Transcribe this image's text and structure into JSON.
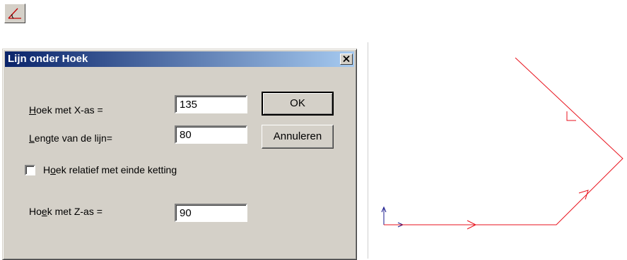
{
  "toolbar": {
    "icon": "angle-line-icon"
  },
  "dialog": {
    "title": "Lijn onder Hoek",
    "fields": [
      {
        "label_u": "H",
        "label_rest": "oek met X-as =",
        "value": "135"
      },
      {
        "label_u": "L",
        "label_rest": "engte van de lijn=",
        "value": "80"
      }
    ],
    "checkbox": {
      "label_pre": "H",
      "label_u": "o",
      "label_rest": "ek relatief met einde ketting",
      "checked": false
    },
    "z_field": {
      "label_pre": "Ho",
      "label_u": "e",
      "label_rest": "k met Z-as =",
      "value": "90"
    },
    "ok_label": "OK",
    "cancel_label": "Annuleren"
  },
  "colors": {
    "line": "#e8121c",
    "axis": "#1a1a8c",
    "title_bar": "#0a246a"
  }
}
